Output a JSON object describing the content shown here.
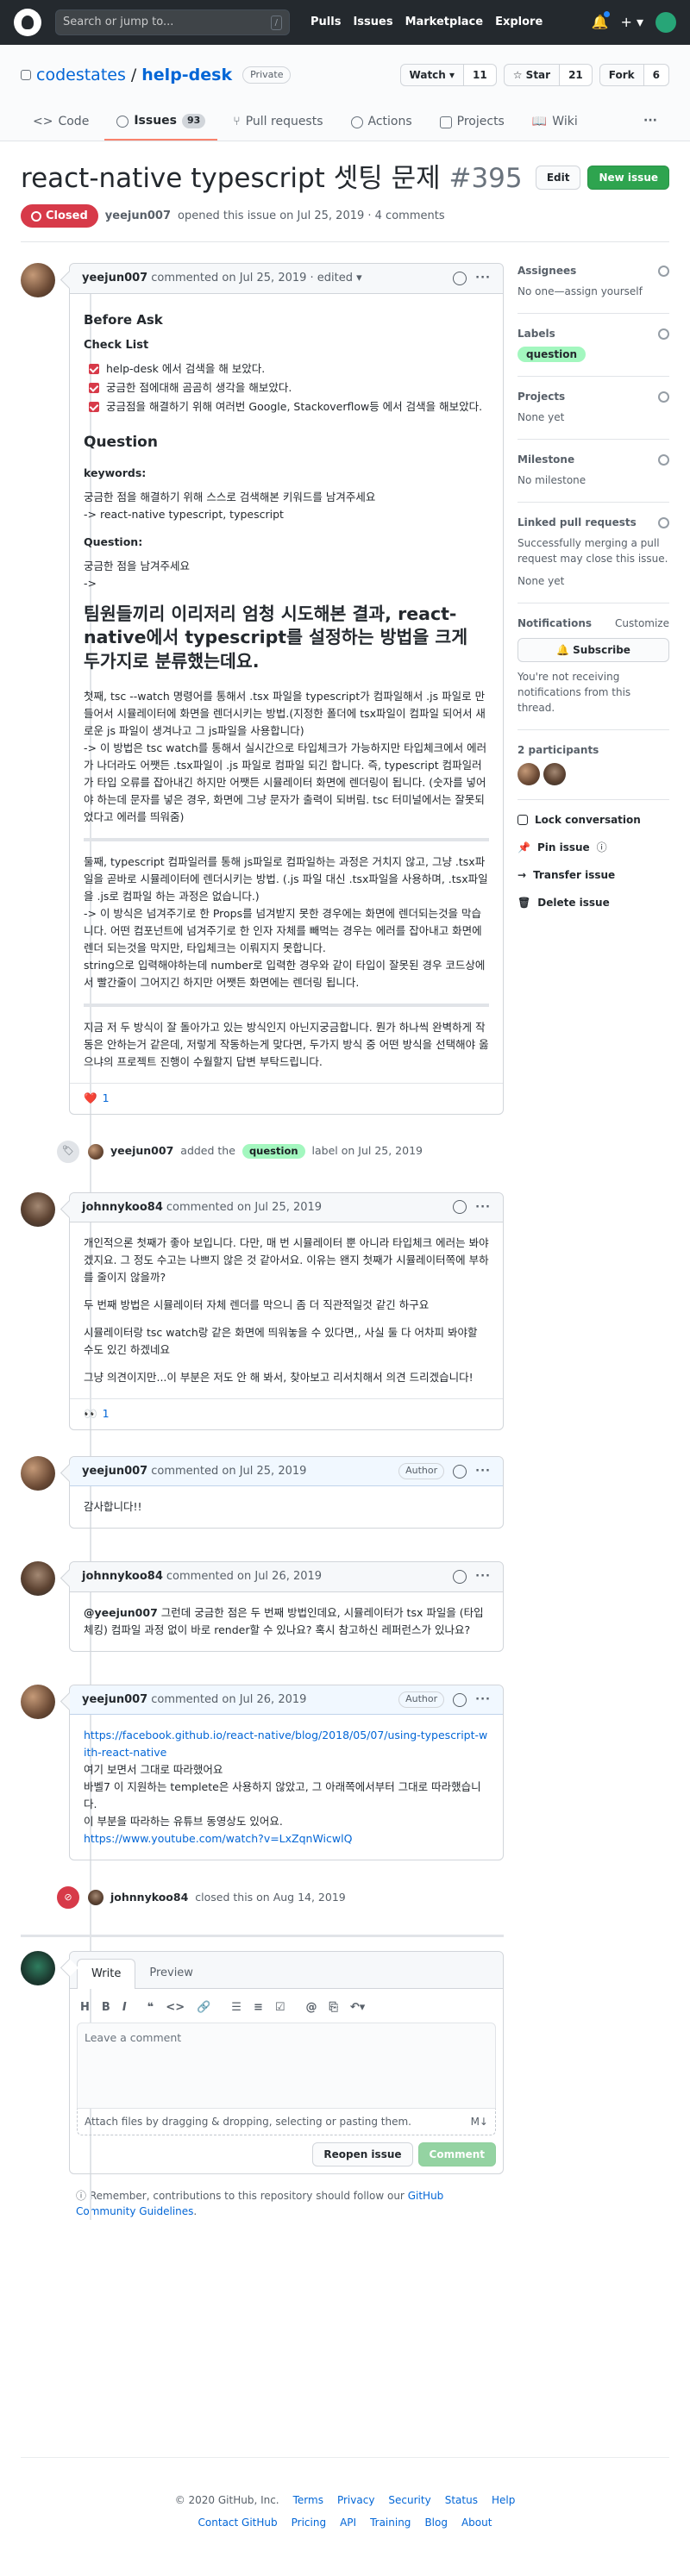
{
  "header": {
    "search_placeholder": "Search or jump to...",
    "slash": "/",
    "nav": [
      "Pulls",
      "Issues",
      "Marketplace",
      "Explore"
    ],
    "plus": "+ ▾"
  },
  "repo": {
    "owner": "codestates",
    "separator": "/",
    "name": "help-desk",
    "visibility": "Private",
    "watch_label": "Watch ▾",
    "watch_count": "11",
    "star_label": "☆ Star",
    "star_count": "21",
    "fork_label": "Fork",
    "fork_count": "6",
    "tabs": [
      {
        "label": "Code"
      },
      {
        "label": "Issues",
        "count": "93"
      },
      {
        "label": "Pull requests"
      },
      {
        "label": "Actions"
      },
      {
        "label": "Projects"
      },
      {
        "label": "Wiki"
      }
    ],
    "more": "···"
  },
  "issue": {
    "title": "react-native typescript 셋팅 문제",
    "number": "#395",
    "edit_label": "Edit",
    "new_label": "New issue",
    "state": "Closed",
    "author": "yeejun007",
    "meta_text": "opened this issue on Jul 25, 2019 · 4 comments"
  },
  "comments": [
    {
      "author": "yeejun007",
      "meta": "commented on Jul 25, 2019 · edited ▾",
      "body": {
        "h_before": "Before Ask",
        "h_check": "Check List",
        "tasks": [
          "help-desk 에서 검색을 해 보았다.",
          "궁금한 점에대해 곰곰히 생각을 해보았다.",
          "궁금점을 해결하기 위해 여러번 Google, Stackoverflow등 에서 검색을 해보았다."
        ],
        "h_question": "Question",
        "keywords_label": "keywords:",
        "keywords_text": "궁금한 점을 해결하기 위해 스스로 검색해본 키워드를 남겨주세요",
        "keywords_value": "-> react-native typescript, typescript",
        "question_label": "Question:",
        "question_text": "궁금한 점을 남겨주세요",
        "question_arrow": "->",
        "big_heading": "팀원들끼리 이리저리 엄청 시도해본 결과, react-native에서 typescript를 설정하는 방법을 크게 두가지로 분류했는데요.",
        "p1": "첫째, tsc --watch 명령어를 통해서 .tsx 파일을 typescript가 컴파일해서 .js 파일로 만들어서 시뮬레이터에 화면을 렌더시키는 방법.(지정한 폴더에 tsx파일이 컴파일 되어서 새로운 js 파일이 생겨나고 그 js파일을 사용합니다)",
        "p2": "-> 이 방법은 tsc watch를 통해서 실시간으로 타입체크가 가능하지만 타입체크에서 에러가 나더라도 어쨋든 .tsx파일이 .js 파일로 컴파일 되긴 합니다. 즉, typescript 컴파일러가 타입 오류를 잡아내긴 하지만 어쨋든 시뮬레이터 화면에 렌더링이 됩니다. (숫자를 넣어야 하는데 문자를 넣은 경우, 화면에 그냥 문자가 출력이 되버림. tsc 터미널에서는 잘못되었다고 에러를 띄워줌)",
        "p3": "둘째, typescript 컴파일러를 통해 js파일로 컴파일하는 과정은 거치지 않고, 그냥 .tsx파일을 곧바로 시뮬레이터에 렌더시키는 방법. (.js 파일 대신 .tsx파일을 사용하며, .tsx파일을 .js로 컴파일 하는 과정은 없습니다.)",
        "p4": "-> 이 방식은 넘겨주기로 한 Props를 넘겨받지 못한 경우에는 화면에 렌더되는것을 막습니다. 어떤 컴포넌트에 넘겨주기로 한 인자 자체를 빼먹는 경우는 에러를 잡아내고 화면에 렌더 되는것을 막지만, 타입체크는 이뤄지지 못합니다.",
        "p5": "string으로 입력해야하는데 number로 입력한 경우와 같이 타입이 잘못된 경우 코드상에서 빨간줄이 그어지긴 하지만 어쨋든 화면에는 렌더링 됩니다.",
        "p6": "지금 저 두 방식이 잘 돌아가고 있는 방식인지 아닌지궁금합니다. 뭔가 하나씩 완벽하게 작동은 안하는거 같은데, 저렇게 작동하는게 맞다면, 두가지 방식 중 어떤 방식을 선택해야 옳으냐의 프로젝트 진행이 수월할지 답변 부탁드립니다."
      },
      "reaction": {
        "emoji": "❤️",
        "count": "1"
      }
    },
    {
      "author": "johnnykoo84",
      "meta": "commented on Jul 25, 2019",
      "p1": "개인적으론 첫째가 좋아 보입니다. 다만, 매 번 시뮬레이터 뿐 아니라 타입체크 에러는 봐야겠지요. 그 정도 수고는 나쁘지 않은 것 같아서요. 이유는 왠지 첫째가 시뮬레이터쪽에 부하를 줄이지 않을까?",
      "p2": "두 번째 방법은 시뮬레이터 자체 렌더를 막으니 좀 더 직관적일것 같긴 하구요",
      "p3": "시뮬레이터랑 tsc watch랑 같은 화면에 띄워놓을 수 있다면,, 사실 둘 다 어차피 봐야할 수도 있긴 하겠네요",
      "p4": "그냥 의견이지만...이 부분은 저도 안 해 봐서, 찾아보고 리서치해서 의견 드리겠습니다!",
      "reaction": {
        "emoji": "👀",
        "count": "1"
      }
    },
    {
      "author": "yeejun007",
      "meta": "commented on Jul 25, 2019",
      "badge": "Author",
      "p1": "감사합니다!!"
    },
    {
      "author": "johnnykoo84",
      "meta": "commented on Jul 26, 2019",
      "mention": "@yeejun007",
      "p1": " 그런데 궁금한 점은 두 번째 방법인데요, 시뮬레이터가 tsx 파일을 (타입 체킹) 컴파일 과정 없이 바로 render할 수 있나요? 혹시 참고하신 레퍼런스가 있나요?"
    },
    {
      "author": "yeejun007",
      "meta": "commented on Jul 26, 2019",
      "badge": "Author",
      "link1": "https://facebook.github.io/react-native/blog/2018/05/07/using-typescript-with-react-native",
      "l2": "여기 보면서 그대로 따라했어요",
      "l3": "바벨7 이 지원하는 templete은 사용하지 않았고, 그 아래쪽에서부터 그대로 따라했습니다.",
      "l4": "이 부분을 따라하는 유튜브 동영상도 있어요.",
      "link2": "https://www.youtube.com/watch?v=LxZqnWicwlQ"
    }
  ],
  "events": {
    "label_event": {
      "author": "yeejun007",
      "pre": "added the",
      "label": "question",
      "post": "label on Jul 25, 2019"
    },
    "close_event": {
      "author": "johnnykoo84",
      "text": "closed this on Aug 14, 2019"
    }
  },
  "compose": {
    "tab_write": "Write",
    "tab_preview": "Preview",
    "placeholder": "Leave a comment",
    "attach": "Attach files by dragging & dropping, selecting or pasting them.",
    "md_icon": "M↓",
    "reopen": "Reopen issue",
    "comment": "Comment",
    "note_pre": "Remember, contributions to this repository should follow our",
    "note_link": "GitHub Community Guidelines",
    "note_post": "."
  },
  "sidebar": {
    "assignees_title": "Assignees",
    "assignees_value": "No one—assign yourself",
    "labels_title": "Labels",
    "labels_value": "question",
    "projects_title": "Projects",
    "projects_value": "None yet",
    "milestone_title": "Milestone",
    "milestone_value": "No milestone",
    "linked_title": "Linked pull requests",
    "linked_desc": "Successfully merging a pull request may close this issue.",
    "linked_value": "None yet",
    "notif_title": "Notifications",
    "notif_customize": "Customize",
    "subscribe": "Subscribe",
    "notif_desc": "You're not receiving notifications from this thread.",
    "participants_title": "2 participants",
    "actions": [
      "Lock conversation",
      "Pin issue",
      "Transfer issue",
      "Delete issue"
    ]
  },
  "footer": {
    "copyright": "© 2020 GitHub, Inc.",
    "row1": [
      "Terms",
      "Privacy",
      "Security",
      "Status",
      "Help"
    ],
    "row2": [
      "Contact GitHub",
      "Pricing",
      "API",
      "Training",
      "Blog",
      "About"
    ]
  },
  "colors": {
    "closed": "#d73a49",
    "green": "#2ea44f",
    "link": "#0366d6",
    "label_question": "#a3f7bf"
  }
}
